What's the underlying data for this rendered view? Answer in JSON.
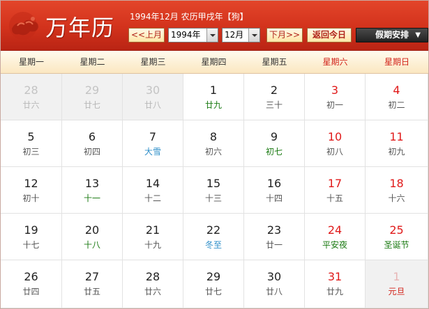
{
  "header": {
    "title": "万年历",
    "info": "1994年12月 农历甲戌年【狗】",
    "prev_label": "<<上月",
    "next_label": "下月>>",
    "year_value": "1994年",
    "month_value": "12月",
    "today_label": "返回今日",
    "holiday_label": "假期安排",
    "holiday_arrow": "▼"
  },
  "colors": {
    "header_red": "#d2321c",
    "weekend_red": "#e01a1a",
    "solar_term_blue": "#2f8fc9",
    "festival_green": "#1a7a12"
  },
  "weekdays": [
    "星期一",
    "星期二",
    "星期三",
    "星期四",
    "星期五",
    "星期六",
    "星期日"
  ],
  "weeks": [
    [
      {
        "day": "28",
        "lunar": "廿六",
        "other": true
      },
      {
        "day": "29",
        "lunar": "廿七",
        "other": true
      },
      {
        "day": "30",
        "lunar": "廿八",
        "other": true
      },
      {
        "day": "1",
        "lunar": "廿九",
        "style": "green"
      },
      {
        "day": "2",
        "lunar": "三十"
      },
      {
        "day": "3",
        "lunar": "初一"
      },
      {
        "day": "4",
        "lunar": "初二"
      }
    ],
    [
      {
        "day": "5",
        "lunar": "初三"
      },
      {
        "day": "6",
        "lunar": "初四"
      },
      {
        "day": "7",
        "lunar": "大雪",
        "style": "blue"
      },
      {
        "day": "8",
        "lunar": "初六"
      },
      {
        "day": "9",
        "lunar": "初七",
        "style": "green"
      },
      {
        "day": "10",
        "lunar": "初八"
      },
      {
        "day": "11",
        "lunar": "初九"
      }
    ],
    [
      {
        "day": "12",
        "lunar": "初十"
      },
      {
        "day": "13",
        "lunar": "十一",
        "style": "green"
      },
      {
        "day": "14",
        "lunar": "十二"
      },
      {
        "day": "15",
        "lunar": "十三"
      },
      {
        "day": "16",
        "lunar": "十四"
      },
      {
        "day": "17",
        "lunar": "十五"
      },
      {
        "day": "18",
        "lunar": "十六"
      }
    ],
    [
      {
        "day": "19",
        "lunar": "十七"
      },
      {
        "day": "20",
        "lunar": "十八",
        "style": "green"
      },
      {
        "day": "21",
        "lunar": "十九"
      },
      {
        "day": "22",
        "lunar": "冬至",
        "style": "blue"
      },
      {
        "day": "23",
        "lunar": "廿一"
      },
      {
        "day": "24",
        "lunar": "平安夜",
        "style": "green"
      },
      {
        "day": "25",
        "lunar": "圣诞节",
        "style": "green"
      }
    ],
    [
      {
        "day": "26",
        "lunar": "廿四"
      },
      {
        "day": "27",
        "lunar": "廿五"
      },
      {
        "day": "28",
        "lunar": "廿六"
      },
      {
        "day": "29",
        "lunar": "廿七"
      },
      {
        "day": "30",
        "lunar": "廿八"
      },
      {
        "day": "31",
        "lunar": "廿九"
      },
      {
        "day": "1",
        "lunar": "元旦",
        "other": true,
        "style": "red"
      }
    ]
  ]
}
